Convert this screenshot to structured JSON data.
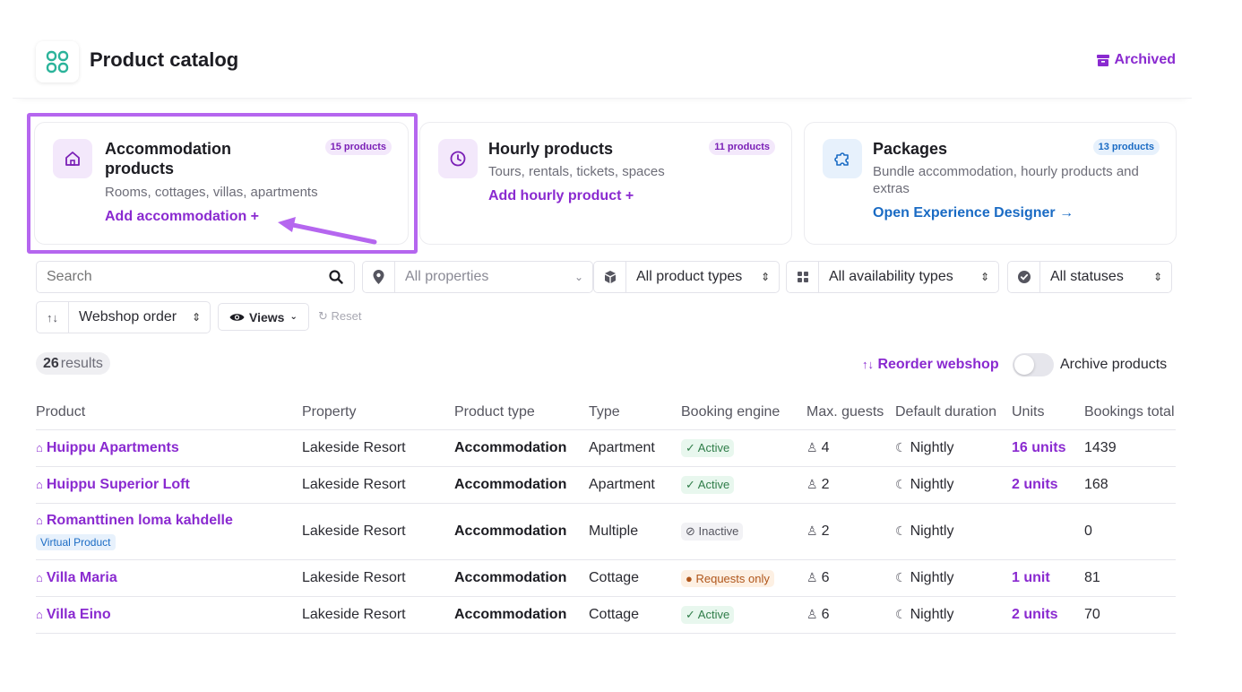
{
  "header": {
    "title": "Product catalog",
    "archived_label": "Archived"
  },
  "colors": {
    "accent": "#8a2ad0",
    "highlight": "#b566ef",
    "active": "#2f7d49",
    "requests": "#b0561b",
    "blue": "#1a6bc4"
  },
  "cards": [
    {
      "title": "Accommodation products",
      "badge": "15 products",
      "description": "Rooms, cottages, villas, apartments",
      "link": "Add accommodation +",
      "icon": "home-icon"
    },
    {
      "title": "Hourly products",
      "badge": "11 products",
      "description": "Tours, rentals, tickets, spaces",
      "link": "Add hourly product +",
      "icon": "clock-icon"
    },
    {
      "title": "Packages",
      "badge": "13 products",
      "description": "Bundle accommodation, hourly products and extras",
      "link": "Open Experience Designer →",
      "icon": "puzzle-icon"
    }
  ],
  "filters": {
    "search_placeholder": "Search",
    "property": "All properties",
    "product_type": "All product types",
    "availability": "All availability types",
    "status": "All statuses",
    "sort": "Webshop order",
    "views": "Views",
    "reset": "Reset"
  },
  "results": {
    "count": "26",
    "label": "results"
  },
  "reorder_label": "Reorder webshop",
  "archive_toggle_label": "Archive products",
  "table": {
    "headers": {
      "product": "Product",
      "property": "Property",
      "product_type": "Product type",
      "type": "Type",
      "booking_engine": "Booking engine",
      "max_guests": "Max. guests",
      "default_duration": "Default duration",
      "units": "Units",
      "bookings_total": "Bookings total"
    },
    "rows": [
      {
        "name": "Huippu Apartments",
        "property": "Lakeside Resort",
        "product_type": "Accommodation",
        "type": "Apartment",
        "status": "Active",
        "guests": "4",
        "duration": "Nightly",
        "units": "16 units",
        "bookings": "1439"
      },
      {
        "name": "Huippu Superior Loft",
        "property": "Lakeside Resort",
        "product_type": "Accommodation",
        "type": "Apartment",
        "status": "Active",
        "guests": "2",
        "duration": "Nightly",
        "units": "2 units",
        "bookings": "168"
      },
      {
        "name": "Romanttinen loma kahdelle",
        "badge": "Virtual Product",
        "property": "Lakeside Resort",
        "product_type": "Accommodation",
        "type": "Multiple",
        "status": "Inactive",
        "guests": "2",
        "duration": "Nightly",
        "units": "",
        "bookings": "0"
      },
      {
        "name": "Villa Maria",
        "property": "Lakeside Resort",
        "product_type": "Accommodation",
        "type": "Cottage",
        "status": "Requests only",
        "guests": "6",
        "duration": "Nightly",
        "units": "1 unit",
        "bookings": "81"
      },
      {
        "name": "Villa Eino",
        "property": "Lakeside Resort",
        "product_type": "Accommodation",
        "type": "Cottage",
        "status": "Active",
        "guests": "6",
        "duration": "Nightly",
        "units": "2 units",
        "bookings": "70"
      }
    ]
  }
}
